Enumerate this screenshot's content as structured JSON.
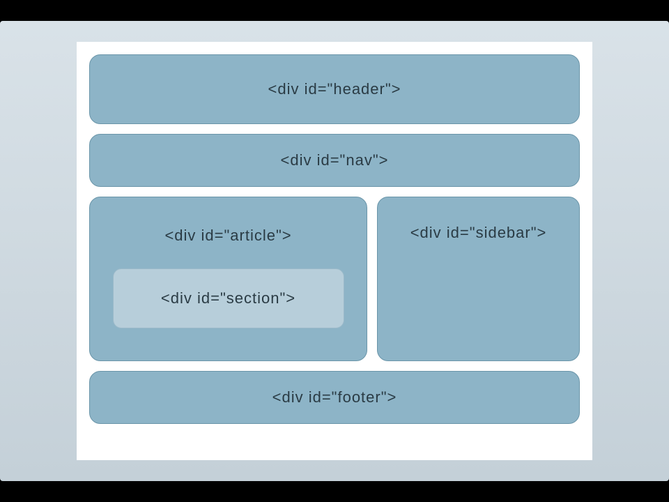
{
  "layout": {
    "header": "<div id=\"header\">",
    "nav": "<div id=\"nav\">",
    "article": "<div id=\"article\">",
    "section": "<div id=\"section\">",
    "sidebar": "<div id=\"sidebar\">",
    "footer": "<div id=\"footer\">"
  }
}
